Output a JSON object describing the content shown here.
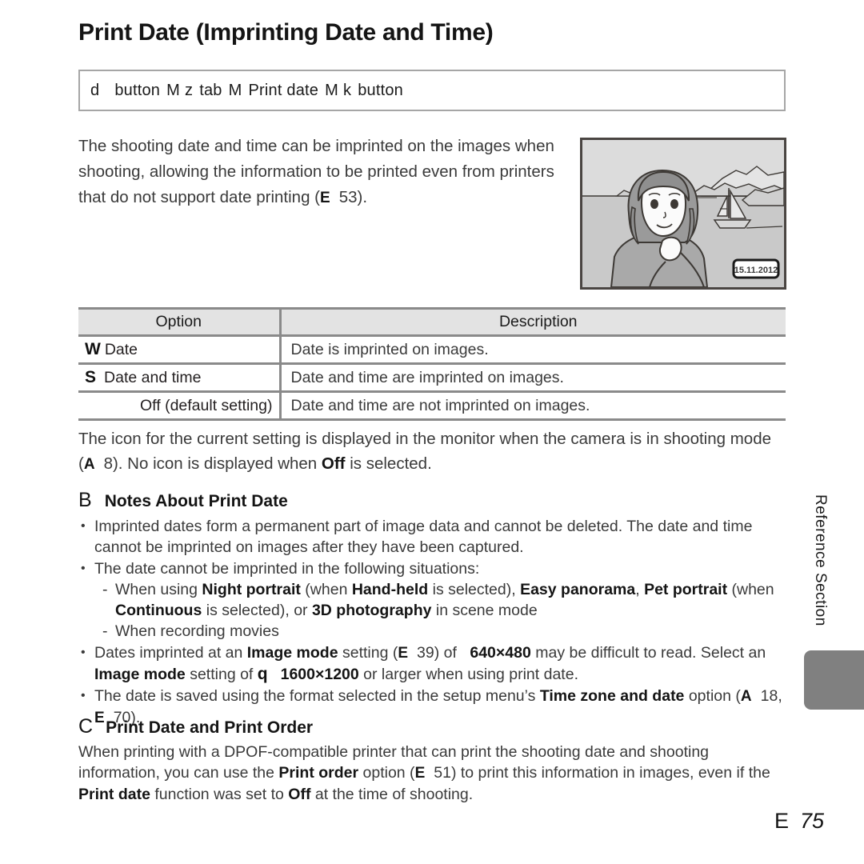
{
  "page": {
    "title": "Print Date (Imprinting Date and Time)",
    "footer_symbol": "E",
    "footer_page": "75",
    "side_tab_label": "Reference Section"
  },
  "nav_path": {
    "icon_menu": "d",
    "label_button_1": "button",
    "arrow_1": "M",
    "icon_setup_tab": "z",
    "label_tab": "tab",
    "arrow_2": "M",
    "label_print_date": "Print date",
    "arrow_3": "M",
    "icon_ok": "k",
    "label_button_2": "button"
  },
  "intro": {
    "text_1": "The shooting date and time can be imprinted on the images when shooting, allowing the information to be printed even from printers that do not support date printing (",
    "ref_symbol": "E",
    "ref_page": "53",
    "text_2": ")."
  },
  "illustration": {
    "date_stamp": "15.11.2012",
    "alt": "Photo of woman with sailboat and mountains, date imprinted in corner"
  },
  "table": {
    "headers": [
      "Option",
      "Description"
    ],
    "rows": [
      {
        "symbol": "W",
        "option": "Date",
        "align": "left",
        "description": "Date is imprinted on images."
      },
      {
        "symbol": "S",
        "option": "Date and time",
        "align": "left",
        "description": "Date and time are imprinted on images."
      },
      {
        "symbol": "",
        "option": "Off (default setting)",
        "align": "right",
        "description": "Date and time are not imprinted on images."
      }
    ]
  },
  "after_table": {
    "text_1": "The icon for the current setting is displayed in the monitor when the camera is in shooting mode (",
    "ref_symbol": "A",
    "ref_page": "8",
    "text_2": "). No icon is displayed when ",
    "bold_off": "Off",
    "text_3": " is selected."
  },
  "notes_print_date": {
    "badge": "B",
    "heading": "Notes About Print Date",
    "bullet_1": "Imprinted dates form a permanent part of image data and cannot be deleted. The date and time cannot be imprinted on images after they have been captured.",
    "bullet_2_intro": "The date cannot be imprinted in the following situations:",
    "sub_1": {
      "t1": "When using ",
      "b1": "Night portrait",
      "t2": " (when ",
      "b2": "Hand-held",
      "t3": " is selected), ",
      "b3": "Easy panorama",
      "t4": ", ",
      "b4": "Pet portrait",
      "t5": " (when ",
      "b5": "Continuous",
      "t6": " is selected), or ",
      "b6": "3D photography",
      "t7": " in scene mode"
    },
    "sub_2": "When recording movies",
    "bullet_3": {
      "t1": "Dates imprinted at an ",
      "b1": "Image mode",
      "t2": " setting (",
      "ref_symbol": "E",
      "ref_page": "39",
      "t3": ") of ",
      "size_small": "640×480",
      "t4": " may be difficult to read. Select an ",
      "b2": "Image mode",
      "t5": " setting of ",
      "icon_q": "q",
      "size_large": "1600×1200",
      "t6": " or larger when using print date."
    },
    "bullet_4": {
      "t1": "The date is saved using the format selected in the setup menu’s ",
      "b1": "Time zone and date",
      "t2": " option (",
      "ref_symbol_1": "A",
      "ref_page_1": "18",
      "t3": ", ",
      "ref_symbol_2": "E",
      "ref_page_2": "70",
      "t4": ")."
    }
  },
  "notes_print_order": {
    "badge": "C",
    "heading": "Print Date and Print Order",
    "body": {
      "t1": "When printing with a DPOF-compatible printer that can print the shooting date and shooting information, you can use the ",
      "b1": "Print order",
      "t2": " option (",
      "ref_symbol": "E",
      "ref_page": "51",
      "t3": ") to print this information in images, even if the ",
      "b2": "Print date",
      "t4": " function was set to ",
      "b3": "Off",
      "t5": " at the time of shooting."
    }
  },
  "colors": {
    "text": "#3a3a3a",
    "heading": "#141414",
    "table_header_bg": "#e3e3e3",
    "rule": "#8a8a8a",
    "box_border": "#a6a6a6",
    "side_tab": "#808080"
  }
}
